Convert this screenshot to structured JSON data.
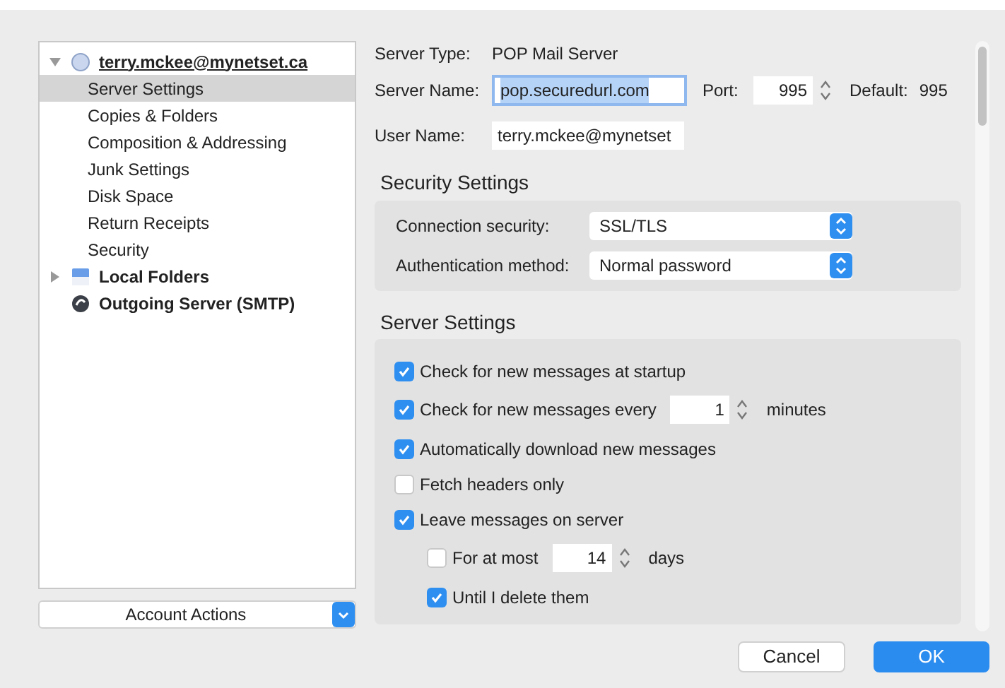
{
  "sidebar": {
    "items": [
      {
        "label": "terry.mckee@mynetset.ca",
        "kind": "account",
        "expanded": true,
        "selected": false,
        "children": [
          {
            "label": "Server Settings",
            "selected": true
          },
          {
            "label": "Copies & Folders",
            "selected": false
          },
          {
            "label": "Composition & Addressing",
            "selected": false
          },
          {
            "label": "Junk Settings",
            "selected": false
          },
          {
            "label": "Disk Space",
            "selected": false
          },
          {
            "label": "Return Receipts",
            "selected": false
          },
          {
            "label": "Security",
            "selected": false
          }
        ]
      },
      {
        "label": "Local Folders",
        "kind": "folders",
        "expanded": false,
        "selected": false
      },
      {
        "label": "Outgoing Server (SMTP)",
        "kind": "smtp",
        "selected": false
      }
    ],
    "actions": "Account Actions"
  },
  "server": {
    "type_label": "Server Type:",
    "type_value": "POP Mail Server",
    "name_label": "Server Name:",
    "name_value": "pop.securedurl.com",
    "port_label": "Port:",
    "port_value": "995",
    "default_label": "Default:",
    "default_value": "995",
    "user_label": "User Name:",
    "user_value": "terry.mckee@mynetset"
  },
  "security": {
    "title": "Security Settings",
    "fields": [
      {
        "label": "Connection security:",
        "value": "SSL/TLS"
      },
      {
        "label": "Authentication method:",
        "value": "Normal password"
      }
    ]
  },
  "server_settings": {
    "title": "Server Settings",
    "options": [
      {
        "label": "Check for new messages at startup",
        "checked": true
      },
      {
        "label": "Check for new messages every",
        "checked": true,
        "value": "1",
        "unit": "minutes"
      },
      {
        "label": "Automatically download new messages",
        "checked": true
      },
      {
        "label": "Fetch headers only",
        "checked": false
      },
      {
        "label": "Leave messages on server",
        "checked": true,
        "children": [
          {
            "label": "For at most",
            "checked": false,
            "value": "14",
            "unit": "days"
          },
          {
            "label": "Until I delete them",
            "checked": true
          }
        ]
      }
    ]
  },
  "buttons": [
    {
      "label": "Cancel",
      "kind": "secondary"
    },
    {
      "label": "OK",
      "kind": "primary"
    }
  ]
}
